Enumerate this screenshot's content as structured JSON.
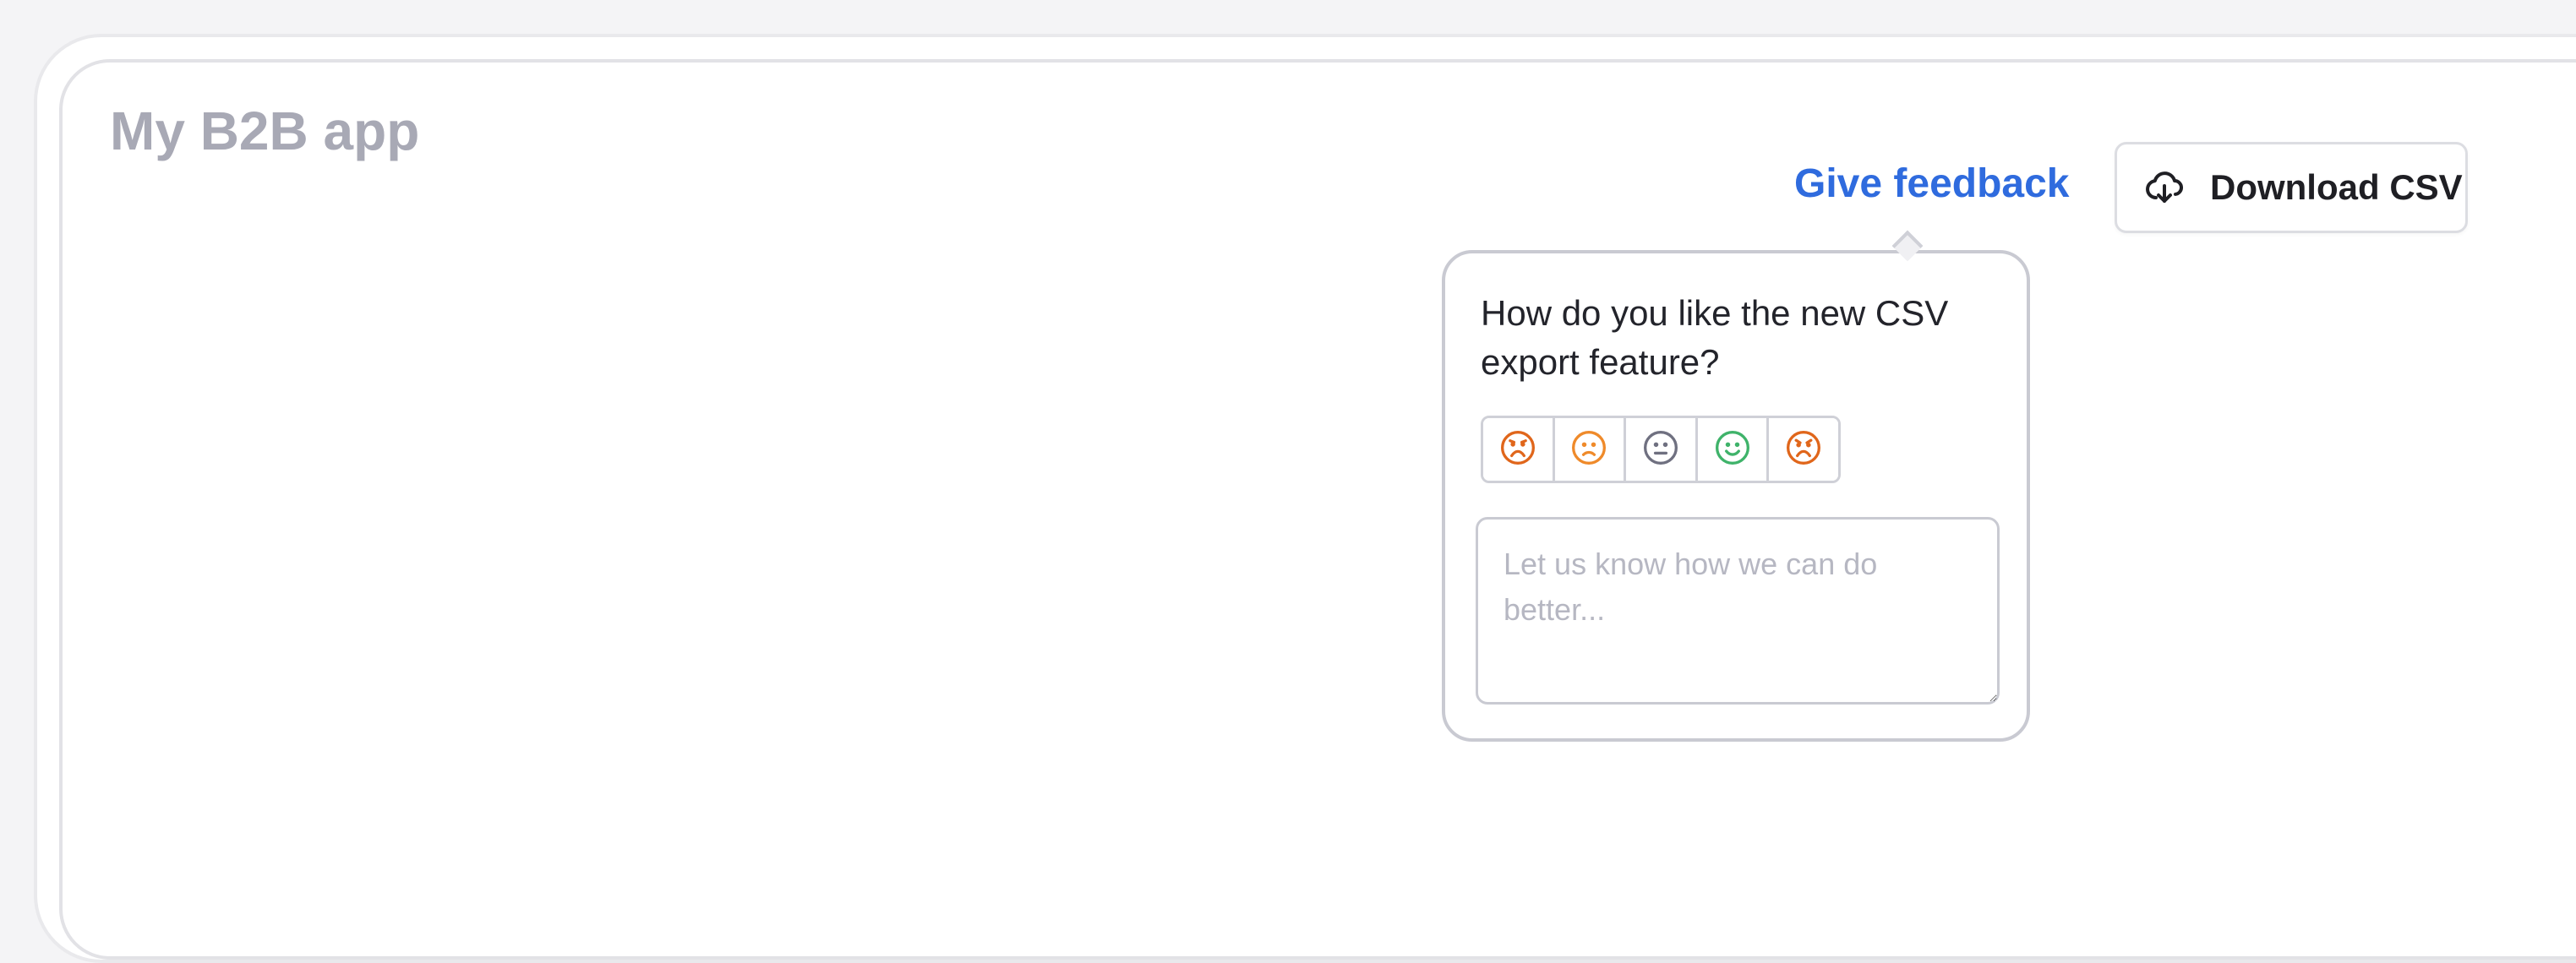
{
  "app": {
    "title": "My B2B app"
  },
  "header": {
    "feedback_link": "Give feedback",
    "download_button": {
      "label": "Download CSV",
      "icon": "cloud-download-icon"
    }
  },
  "feedback_popover": {
    "question": "How do you like the new CSV export feature?",
    "rating_options": [
      {
        "icon": "very-sad-face-icon",
        "color": "#e0661b"
      },
      {
        "icon": "sad-face-icon",
        "color": "#ef8a2a"
      },
      {
        "icon": "neutral-face-icon",
        "color": "#6f7080"
      },
      {
        "icon": "happy-face-icon",
        "color": "#3fb36a"
      },
      {
        "icon": "angry-face-icon",
        "color": "#e0661b"
      }
    ],
    "comment": {
      "placeholder": "Let us know how we can do better...",
      "value": ""
    }
  },
  "colors": {
    "accent": "#2f6bde",
    "muted_title": "#a8a9b5",
    "border": "#c9cad2"
  }
}
